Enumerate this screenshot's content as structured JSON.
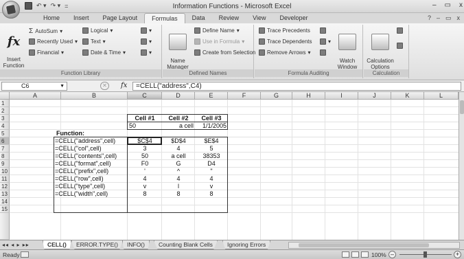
{
  "window": {
    "title": "Information Functions - Microsoft Excel",
    "controls": {
      "minimize": "–",
      "restore": "▭",
      "close": "x"
    }
  },
  "qat": {
    "undo": "↶ ▾",
    "redo": "↷ ▾",
    "customize": "="
  },
  "ribbon": {
    "tabs": [
      "Home",
      "Insert",
      "Page Layout",
      "Formulas",
      "Data",
      "Review",
      "View",
      "Developer"
    ],
    "active_tab": "Formulas",
    "help": "?",
    "groups": {
      "function_library": {
        "label": "Function Library",
        "insert_function": "Insert\nFunction",
        "autosum": "AutoSum",
        "recently_used": "Recently Used",
        "financial": "Financial",
        "logical": "Logical",
        "text": "Text",
        "date_time": "Date & Time"
      },
      "defined_names": {
        "label": "Defined Names",
        "name_manager": "Name\nManager",
        "define_name": "Define Name",
        "use_in_formula": "Use in Formula",
        "create_from_selection": "Create from Selection"
      },
      "formula_auditing": {
        "label": "Formula Auditing",
        "trace_precedents": "Trace Precedents",
        "trace_dependents": "Trace Dependents",
        "remove_arrows": "Remove Arrows",
        "watch_window": "Watch\nWindow"
      },
      "calculation": {
        "label": "Calculation",
        "calculation_options": "Calculation\nOptions"
      }
    }
  },
  "formula_bar": {
    "name_box": "C6",
    "fx": "fx",
    "formula": "=CELL(\"address\",C4)"
  },
  "grid": {
    "columns": [
      "A",
      "B",
      "C",
      "D",
      "E",
      "F",
      "G",
      "H",
      "I",
      "J",
      "K",
      "L"
    ],
    "rows": [
      "1",
      "2",
      "3",
      "4",
      "5",
      "6",
      "7",
      "8",
      "9",
      "10",
      "11",
      "12",
      "13",
      "14",
      "15"
    ],
    "cells": {
      "C3": "Cell #1",
      "D3": "Cell #2",
      "E3": "Cell #3",
      "C4": "50",
      "D4": "a cell",
      "E4": "1/1/2005",
      "B5": "Function:",
      "B6": "=CELL(\"address\",cell)",
      "C6": "$C$4",
      "D6": "$D$4",
      "E6": "$E$4",
      "B7": "=CELL(\"col\",cell)",
      "C7": "3",
      "D7": "4",
      "E7": "5",
      "B8": "=CELL(\"contents\",cell)",
      "C8": "50",
      "D8": "a cell",
      "E8": "38353",
      "B9": "=CELL(\"format\",cell)",
      "C9": "F0",
      "D9": "G",
      "E9": "D4",
      "B10": "=CELL(\"prefix\",cell)",
      "C10": "'",
      "D10": "^",
      "E10": "\"",
      "B11": "=CELL(\"row\",cell)",
      "C11": "4",
      "D11": "4",
      "E11": "4",
      "B12": "=CELL(\"type\",cell)",
      "C12": "v",
      "D12": "l",
      "E12": "v",
      "B13": "=CELL(\"width\",cell)",
      "C13": "8",
      "D13": "8",
      "E13": "8"
    }
  },
  "sheet_tabs": [
    "CELL()",
    "ERROR.TYPE()",
    "INFO()",
    "Counting Blank Cells",
    "Ignoring Errors"
  ],
  "active_sheet": "CELL()",
  "sheet_nav": "◂◂ ◂ ▸ ▸▸",
  "status": {
    "ready": "Ready",
    "zoom": "100%",
    "zoom_minus": "–",
    "zoom_plus": "+"
  }
}
